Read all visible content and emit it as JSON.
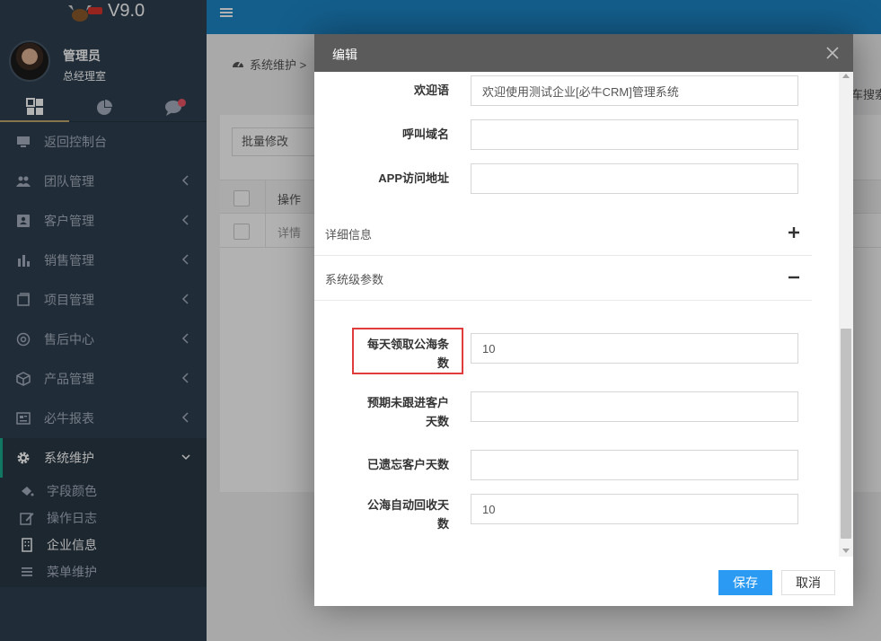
{
  "app": {
    "version": "V9.0"
  },
  "user": {
    "name": "管理员",
    "dept": "总经理室"
  },
  "sidebar": {
    "tabs": [
      {
        "icon": "grid-icon",
        "active": true
      },
      {
        "icon": "pie-chart-icon",
        "active": false
      },
      {
        "icon": "chat-bubble-icon",
        "active": false,
        "badge": true
      }
    ],
    "items": [
      {
        "label": "返回控制台",
        "icon": "monitor-icon"
      },
      {
        "label": "团队管理",
        "icon": "users-icon"
      },
      {
        "label": "客户管理",
        "icon": "address-card-icon"
      },
      {
        "label": "销售管理",
        "icon": "bar-chart-icon"
      },
      {
        "label": "项目管理",
        "icon": "folder-icon"
      },
      {
        "label": "售后中心",
        "icon": "support-icon"
      },
      {
        "label": "产品管理",
        "icon": "cube-icon"
      },
      {
        "label": "必牛报表",
        "icon": "report-icon"
      },
      {
        "label": "系统维护",
        "icon": "gear-icon"
      }
    ],
    "subitems": [
      {
        "label": "字段颜色",
        "icon": "paint-bucket-icon"
      },
      {
        "label": "操作日志",
        "icon": "edit-log-icon"
      },
      {
        "label": "企业信息",
        "icon": "building-icon"
      },
      {
        "label": "菜单维护",
        "icon": "list-icon"
      }
    ]
  },
  "background": {
    "breadcrumb": "系统维护 >",
    "bulk_button": "批量修改",
    "search_partial": "车搜索",
    "table": {
      "header_op": "操作",
      "row1_op": "详情"
    }
  },
  "modal": {
    "title": "编辑",
    "fields_top": [
      {
        "label": "欢迎语",
        "value": "欢迎使用测试企业[必牛CRM]管理系统"
      },
      {
        "label": "呼叫域名",
        "value": ""
      },
      {
        "label": "APP访问地址",
        "value": ""
      }
    ],
    "sections": [
      {
        "title": "详细信息",
        "state": "collapsed"
      },
      {
        "title": "系统级参数",
        "state": "expanded"
      }
    ],
    "fields_system": [
      {
        "label_line1": "每天领取公海条",
        "label_line2": "数",
        "value": "10"
      },
      {
        "label_line1": "预期未跟进客户",
        "label_line2": "天数",
        "value": ""
      },
      {
        "label_line1": "已遗忘客户天数",
        "label_line2": "",
        "value": ""
      },
      {
        "label_line1": "公海自动回收天",
        "label_line2": "数",
        "value": "10"
      }
    ],
    "save": "保存",
    "cancel": "取消"
  },
  "colors": {
    "sidebar_bg": "#2f4050",
    "topbar": "#1e87c9",
    "save_button": "#2b9af3",
    "highlight": "#e03c3c"
  }
}
